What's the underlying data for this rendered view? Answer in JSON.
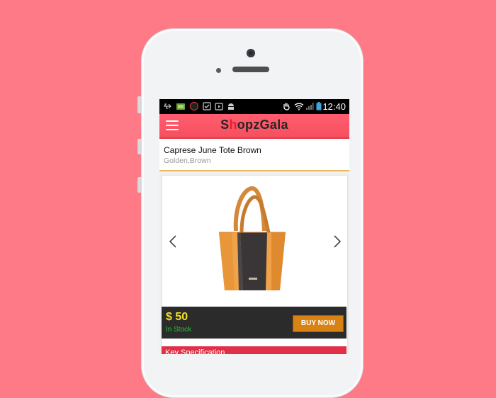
{
  "status_bar": {
    "time": "12:40",
    "left_icons": [
      "usb-icon",
      "battery-app-icon",
      "badge-13-icon",
      "check-icon",
      "play-store-icon",
      "android-icon"
    ],
    "right_icons": [
      "hand-icon",
      "wifi-icon",
      "signal-icon",
      "battery-icon"
    ],
    "badge_text": "13"
  },
  "app_bar": {
    "logo_prefix": "S",
    "logo_accent": "h",
    "logo_suffix": "opzGala",
    "menu_icon": "hamburger-menu-icon",
    "accent_color": "#f6505f"
  },
  "product": {
    "title": "Caprese June Tote Brown",
    "colors": "Golden,Brown",
    "price": "$ 50",
    "stock_status": "In Stock",
    "buy_label": "BUY NOW",
    "image_icon": "tote-bag-image"
  },
  "carousel": {
    "prev_icon": "chevron-left-icon",
    "next_icon": "chevron-right-icon"
  },
  "section": {
    "key_spec_label": "Key Specification"
  }
}
